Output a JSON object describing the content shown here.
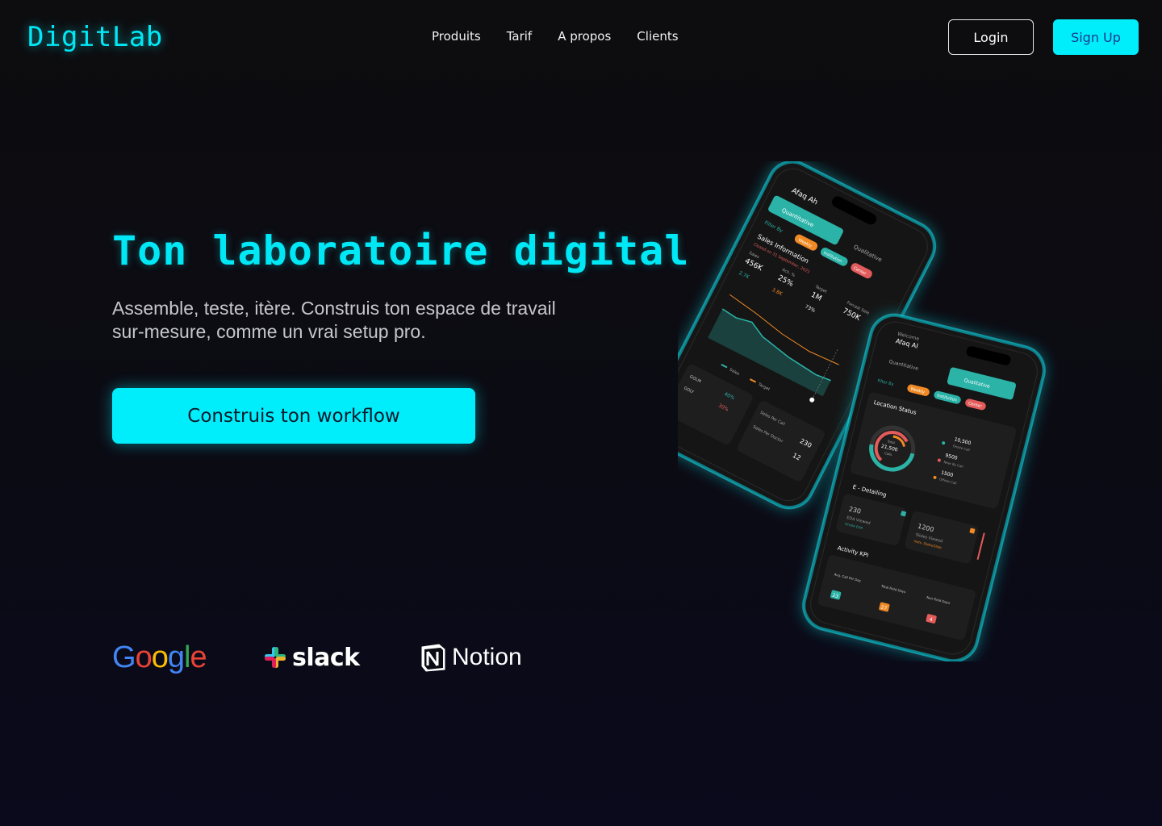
{
  "header": {
    "logo": "DigitLab",
    "nav": [
      "Produits",
      "Tarif",
      "A propos",
      "Clients"
    ],
    "login_label": "Login",
    "signup_label": "Sign Up"
  },
  "hero": {
    "title": "Ton laboratoire digital",
    "subtitle": "Assemble, teste, itère. Construis ton espace de travail sur-mesure, comme un vrai setup pro.",
    "cta_label": "Construis ton workflow"
  },
  "partners": {
    "google": "Google",
    "slack": "slack",
    "notion": "Notion"
  },
  "phone_back": {
    "user": "Afaq Ah",
    "tabs": [
      "Quantitative",
      "Qualitative"
    ],
    "filter_label": "Filter By",
    "chips": [
      "Weekly",
      "Institution",
      "Center"
    ],
    "section": "Sales Information",
    "section_note": "Closed on 31 September, 2021",
    "stats": [
      {
        "label": "Sales",
        "value": "456K"
      },
      {
        "label": "Ach. %",
        "value": "25%"
      },
      {
        "label": "Target",
        "value": "1M"
      },
      {
        "label": "Forcast Sale",
        "value": "750K"
      }
    ],
    "row2": [
      "2.7K",
      "3.8K",
      "73%"
    ],
    "legend": [
      "Sales",
      "Target"
    ],
    "list": [
      {
        "name": "GOLM",
        "value": "40%"
      },
      {
        "name": "GOLY",
        "value": "30%"
      }
    ],
    "calls": [
      {
        "label": "Sales Per Call",
        "value": "230"
      },
      {
        "label": "Sales Per Doctor",
        "value": "12"
      }
    ]
  },
  "phone_front": {
    "welcome": "Welcome",
    "user": "Afaq Al",
    "tabs": [
      "Quantitative",
      "Qualitative"
    ],
    "filter_label": "Filter By",
    "chips": [
      "Weekly",
      "Institution",
      "Center"
    ],
    "location_title": "Location Status",
    "donut_total_label": "Total",
    "donut_total": "21,500",
    "donut_unit": "Calls",
    "legend": [
      {
        "value": "10,500",
        "label": "Onsite Call",
        "color": "#2bb3a8"
      },
      {
        "value": "9500",
        "label": "Near By Call",
        "color": "#e35b5b"
      },
      {
        "value": "1500",
        "label": "Offsite Call",
        "color": "#f08a24"
      }
    ],
    "edetail_title": "E - Detailing",
    "edetail_cards": [
      {
        "value": "230",
        "label": "EDA Viewed",
        "note": "Onsite EDA"
      },
      {
        "value": "1200",
        "label": "Slides Viewed",
        "note": "Insts. Slides/Slide"
      }
    ],
    "activity_title": "Activity KPI",
    "kpis": [
      {
        "label": "Avg. Call Per Day",
        "value": "23",
        "color": "#2bb3a8"
      },
      {
        "label": "Total Field Days",
        "value": "27",
        "color": "#f08a24"
      },
      {
        "label": "Non Field Days",
        "value": "4",
        "color": "#e35b5b"
      }
    ]
  },
  "colors": {
    "accent": "#00eefc",
    "teal": "#2bb3a8",
    "orange": "#f08a24",
    "red": "#e35b5b"
  }
}
